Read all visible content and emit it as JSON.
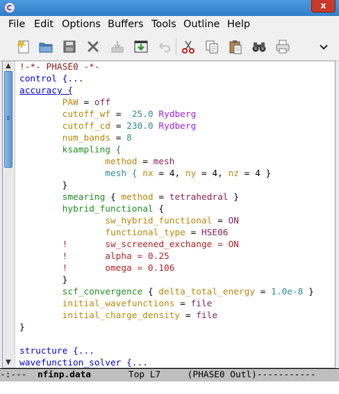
{
  "menu": [
    "File",
    "Edit",
    "Options",
    "Buffers",
    "Tools",
    "Outline",
    "Help"
  ],
  "toolbar_icons": [
    "new-file-icon",
    "open-folder-icon",
    "save-disk-icon",
    "close-x-icon",
    "save-icon",
    "download-icon",
    "undo-icon",
    "cut-icon",
    "copy-icon",
    "paste-icon",
    "search-binoculars-icon",
    "print-icon"
  ],
  "close_label": "x",
  "code_lines": [
    [
      {
        "t": "!-*- PHASE0 -*-",
        "c": "kw"
      }
    ],
    [
      {
        "t": "control {...",
        "c": "blu"
      }
    ],
    [
      {
        "t": "accuracy {",
        "c": "blu ul"
      }
    ],
    [
      {
        "t": "        "
      },
      {
        "t": "PAW",
        "c": "var"
      },
      {
        "t": " = "
      },
      {
        "t": "off",
        "c": "str"
      }
    ],
    [
      {
        "t": "        "
      },
      {
        "t": "cutoff_wf",
        "c": "var"
      },
      {
        "t": " =  "
      },
      {
        "t": "25.0",
        "c": "num"
      },
      {
        "t": " "
      },
      {
        "t": "Rydberg",
        "c": "unit"
      }
    ],
    [
      {
        "t": "        "
      },
      {
        "t": "cutoff_cd",
        "c": "var"
      },
      {
        "t": " = "
      },
      {
        "t": "230.0",
        "c": "num"
      },
      {
        "t": " "
      },
      {
        "t": "Rydberg",
        "c": "unit"
      }
    ],
    [
      {
        "t": "        "
      },
      {
        "t": "num_bands",
        "c": "var"
      },
      {
        "t": " = "
      },
      {
        "t": "8",
        "c": "num"
      }
    ],
    [
      {
        "t": "        "
      },
      {
        "t": "ksampling {",
        "c": "typ"
      }
    ],
    [
      {
        "t": "                "
      },
      {
        "t": "method",
        "c": "var"
      },
      {
        "t": " = "
      },
      {
        "t": "mesh",
        "c": "str"
      }
    ],
    [
      {
        "t": "                "
      },
      {
        "t": "mesh {",
        "c": "num"
      },
      {
        "t": " "
      },
      {
        "t": "nx",
        "c": "var"
      },
      {
        "t": " = 4, "
      },
      {
        "t": "ny",
        "c": "var"
      },
      {
        "t": " = 4, "
      },
      {
        "t": "nz",
        "c": "var"
      },
      {
        "t": " = 4 }"
      }
    ],
    [
      {
        "t": "        }"
      }
    ],
    [
      {
        "t": "        "
      },
      {
        "t": "smearing",
        "c": "typ"
      },
      {
        "t": " { "
      },
      {
        "t": "method",
        "c": "var"
      },
      {
        "t": " = "
      },
      {
        "t": "tetrahedral",
        "c": "str"
      },
      {
        "t": " }"
      }
    ],
    [
      {
        "t": "        "
      },
      {
        "t": "hybrid_functional",
        "c": "typ"
      },
      {
        "t": " {"
      }
    ],
    [
      {
        "t": "                "
      },
      {
        "t": "sw_hybrid_functional",
        "c": "var"
      },
      {
        "t": " = "
      },
      {
        "t": "ON",
        "c": "str"
      }
    ],
    [
      {
        "t": "                "
      },
      {
        "t": "functional_type",
        "c": "var"
      },
      {
        "t": " = "
      },
      {
        "t": "HSE06",
        "c": "str"
      }
    ],
    [
      {
        "t": "        ",
        "c": ""
      },
      {
        "t": "!       sw_screened_exchange = ON",
        "c": "comment-red"
      }
    ],
    [
      {
        "t": "        "
      },
      {
        "t": "!       alpha = 0.25",
        "c": "comment-red"
      }
    ],
    [
      {
        "t": "        "
      },
      {
        "t": "!       omega = 0.106",
        "c": "comment-red"
      }
    ],
    [
      {
        "t": "        }"
      }
    ],
    [
      {
        "t": "        "
      },
      {
        "t": "scf_convergence",
        "c": "typ"
      },
      {
        "t": " { "
      },
      {
        "t": "delta_total_energy",
        "c": "var"
      },
      {
        "t": " = "
      },
      {
        "t": "1.0e-8",
        "c": "num"
      },
      {
        "t": " }"
      }
    ],
    [
      {
        "t": "        "
      },
      {
        "t": "initial_wavefunctions",
        "c": "var"
      },
      {
        "t": " = "
      },
      {
        "t": "file",
        "c": "str"
      }
    ],
    [
      {
        "t": "        "
      },
      {
        "t": "initial_charge_density",
        "c": "var"
      },
      {
        "t": " = "
      },
      {
        "t": "file",
        "c": "str"
      }
    ],
    [
      {
        "t": "}"
      }
    ],
    [
      {
        "t": ""
      }
    ],
    [
      {
        "t": "structure {...",
        "c": "blu"
      }
    ],
    [
      {
        "t": "wavefunction_solver {...",
        "c": "blu"
      }
    ]
  ],
  "modeline": {
    "prefix": "-:---  ",
    "filename": "nfinp.data",
    "position": "       Top L7     ",
    "mode": "(PHASE0 Outl)",
    "fill": "-----------"
  }
}
